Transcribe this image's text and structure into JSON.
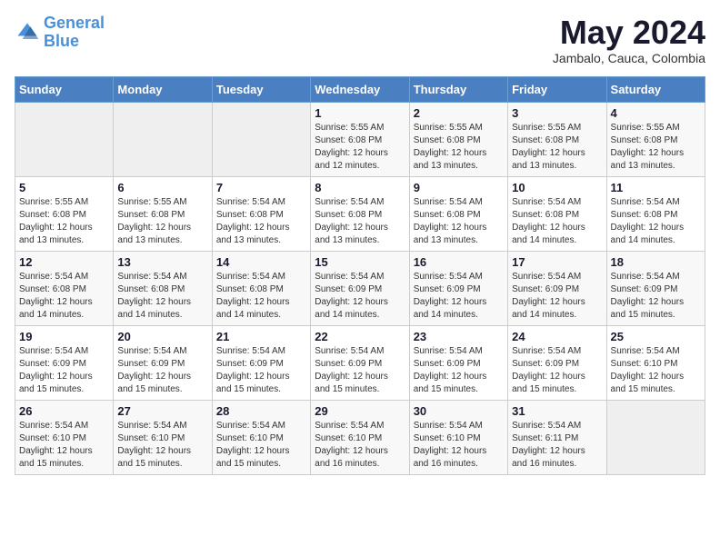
{
  "header": {
    "logo_line1": "General",
    "logo_line2": "Blue",
    "title": "May 2024",
    "subtitle": "Jambalo, Cauca, Colombia"
  },
  "weekdays": [
    "Sunday",
    "Monday",
    "Tuesday",
    "Wednesday",
    "Thursday",
    "Friday",
    "Saturday"
  ],
  "weeks": [
    [
      {
        "day": "",
        "info": ""
      },
      {
        "day": "",
        "info": ""
      },
      {
        "day": "",
        "info": ""
      },
      {
        "day": "1",
        "info": "Sunrise: 5:55 AM\nSunset: 6:08 PM\nDaylight: 12 hours\nand 12 minutes."
      },
      {
        "day": "2",
        "info": "Sunrise: 5:55 AM\nSunset: 6:08 PM\nDaylight: 12 hours\nand 13 minutes."
      },
      {
        "day": "3",
        "info": "Sunrise: 5:55 AM\nSunset: 6:08 PM\nDaylight: 12 hours\nand 13 minutes."
      },
      {
        "day": "4",
        "info": "Sunrise: 5:55 AM\nSunset: 6:08 PM\nDaylight: 12 hours\nand 13 minutes."
      }
    ],
    [
      {
        "day": "5",
        "info": "Sunrise: 5:55 AM\nSunset: 6:08 PM\nDaylight: 12 hours\nand 13 minutes."
      },
      {
        "day": "6",
        "info": "Sunrise: 5:55 AM\nSunset: 6:08 PM\nDaylight: 12 hours\nand 13 minutes."
      },
      {
        "day": "7",
        "info": "Sunrise: 5:54 AM\nSunset: 6:08 PM\nDaylight: 12 hours\nand 13 minutes."
      },
      {
        "day": "8",
        "info": "Sunrise: 5:54 AM\nSunset: 6:08 PM\nDaylight: 12 hours\nand 13 minutes."
      },
      {
        "day": "9",
        "info": "Sunrise: 5:54 AM\nSunset: 6:08 PM\nDaylight: 12 hours\nand 13 minutes."
      },
      {
        "day": "10",
        "info": "Sunrise: 5:54 AM\nSunset: 6:08 PM\nDaylight: 12 hours\nand 14 minutes."
      },
      {
        "day": "11",
        "info": "Sunrise: 5:54 AM\nSunset: 6:08 PM\nDaylight: 12 hours\nand 14 minutes."
      }
    ],
    [
      {
        "day": "12",
        "info": "Sunrise: 5:54 AM\nSunset: 6:08 PM\nDaylight: 12 hours\nand 14 minutes."
      },
      {
        "day": "13",
        "info": "Sunrise: 5:54 AM\nSunset: 6:08 PM\nDaylight: 12 hours\nand 14 minutes."
      },
      {
        "day": "14",
        "info": "Sunrise: 5:54 AM\nSunset: 6:08 PM\nDaylight: 12 hours\nand 14 minutes."
      },
      {
        "day": "15",
        "info": "Sunrise: 5:54 AM\nSunset: 6:09 PM\nDaylight: 12 hours\nand 14 minutes."
      },
      {
        "day": "16",
        "info": "Sunrise: 5:54 AM\nSunset: 6:09 PM\nDaylight: 12 hours\nand 14 minutes."
      },
      {
        "day": "17",
        "info": "Sunrise: 5:54 AM\nSunset: 6:09 PM\nDaylight: 12 hours\nand 14 minutes."
      },
      {
        "day": "18",
        "info": "Sunrise: 5:54 AM\nSunset: 6:09 PM\nDaylight: 12 hours\nand 15 minutes."
      }
    ],
    [
      {
        "day": "19",
        "info": "Sunrise: 5:54 AM\nSunset: 6:09 PM\nDaylight: 12 hours\nand 15 minutes."
      },
      {
        "day": "20",
        "info": "Sunrise: 5:54 AM\nSunset: 6:09 PM\nDaylight: 12 hours\nand 15 minutes."
      },
      {
        "day": "21",
        "info": "Sunrise: 5:54 AM\nSunset: 6:09 PM\nDaylight: 12 hours\nand 15 minutes."
      },
      {
        "day": "22",
        "info": "Sunrise: 5:54 AM\nSunset: 6:09 PM\nDaylight: 12 hours\nand 15 minutes."
      },
      {
        "day": "23",
        "info": "Sunrise: 5:54 AM\nSunset: 6:09 PM\nDaylight: 12 hours\nand 15 minutes."
      },
      {
        "day": "24",
        "info": "Sunrise: 5:54 AM\nSunset: 6:09 PM\nDaylight: 12 hours\nand 15 minutes."
      },
      {
        "day": "25",
        "info": "Sunrise: 5:54 AM\nSunset: 6:10 PM\nDaylight: 12 hours\nand 15 minutes."
      }
    ],
    [
      {
        "day": "26",
        "info": "Sunrise: 5:54 AM\nSunset: 6:10 PM\nDaylight: 12 hours\nand 15 minutes."
      },
      {
        "day": "27",
        "info": "Sunrise: 5:54 AM\nSunset: 6:10 PM\nDaylight: 12 hours\nand 15 minutes."
      },
      {
        "day": "28",
        "info": "Sunrise: 5:54 AM\nSunset: 6:10 PM\nDaylight: 12 hours\nand 15 minutes."
      },
      {
        "day": "29",
        "info": "Sunrise: 5:54 AM\nSunset: 6:10 PM\nDaylight: 12 hours\nand 16 minutes."
      },
      {
        "day": "30",
        "info": "Sunrise: 5:54 AM\nSunset: 6:10 PM\nDaylight: 12 hours\nand 16 minutes."
      },
      {
        "day": "31",
        "info": "Sunrise: 5:54 AM\nSunset: 6:11 PM\nDaylight: 12 hours\nand 16 minutes."
      },
      {
        "day": "",
        "info": ""
      }
    ]
  ]
}
